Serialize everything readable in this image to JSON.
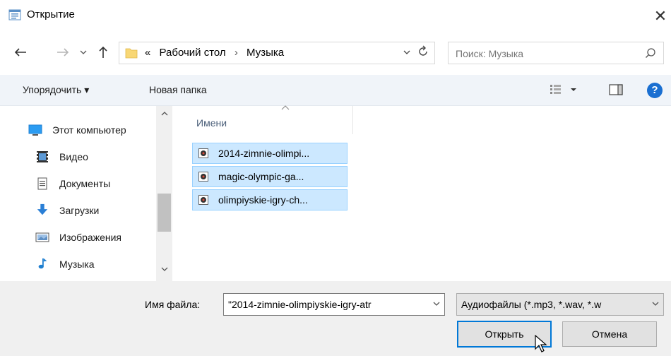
{
  "window": {
    "title": "Открытие",
    "close_glyph": "✕"
  },
  "nav": {
    "back_icon": "arrow-left",
    "forward_icon": "arrow-right",
    "recent_icon": "chevron-down",
    "up_icon": "arrow-up",
    "breadcrumb_overflow": "«",
    "breadcrumb": [
      "Рабочий стол",
      "Музыка"
    ],
    "breadcrumb_sep": "›"
  },
  "search": {
    "placeholder": "Поиск: Музыка"
  },
  "toolbar": {
    "organize_label": "Упорядочить ▾",
    "new_folder_label": "Новая папка",
    "help_glyph": "?"
  },
  "sidebar": {
    "items": [
      {
        "label": "Этот компьютер",
        "icon": "computer-icon"
      },
      {
        "label": "Видео",
        "icon": "video-icon"
      },
      {
        "label": "Документы",
        "icon": "documents-icon"
      },
      {
        "label": "Загрузки",
        "icon": "downloads-icon"
      },
      {
        "label": "Изображения",
        "icon": "images-icon"
      },
      {
        "label": "Музыка",
        "icon": "music-icon"
      }
    ]
  },
  "files": {
    "column_name": "Имени",
    "items": [
      {
        "name": "2014-zimnie-olimpi...",
        "selected": true
      },
      {
        "name": "magic-olympic-ga...",
        "selected": true
      },
      {
        "name": "olimpiyskie-igry-ch...",
        "selected": true
      }
    ]
  },
  "footer": {
    "filename_label": "Имя файла:",
    "filename_value": "\"2014-zimnie-olimpiyskie-igry-atr",
    "filetype_value": "Аудиофайлы (*.mp3, *.wav, *.w",
    "open_label": "Открыть",
    "cancel_label": "Отмена"
  },
  "colors": {
    "selection_bg": "#cce8ff",
    "selection_border": "#99d1ff",
    "accent": "#0078d7",
    "toolbar_bg": "#f0f4f9",
    "footer_bg": "#f0f0f0"
  }
}
